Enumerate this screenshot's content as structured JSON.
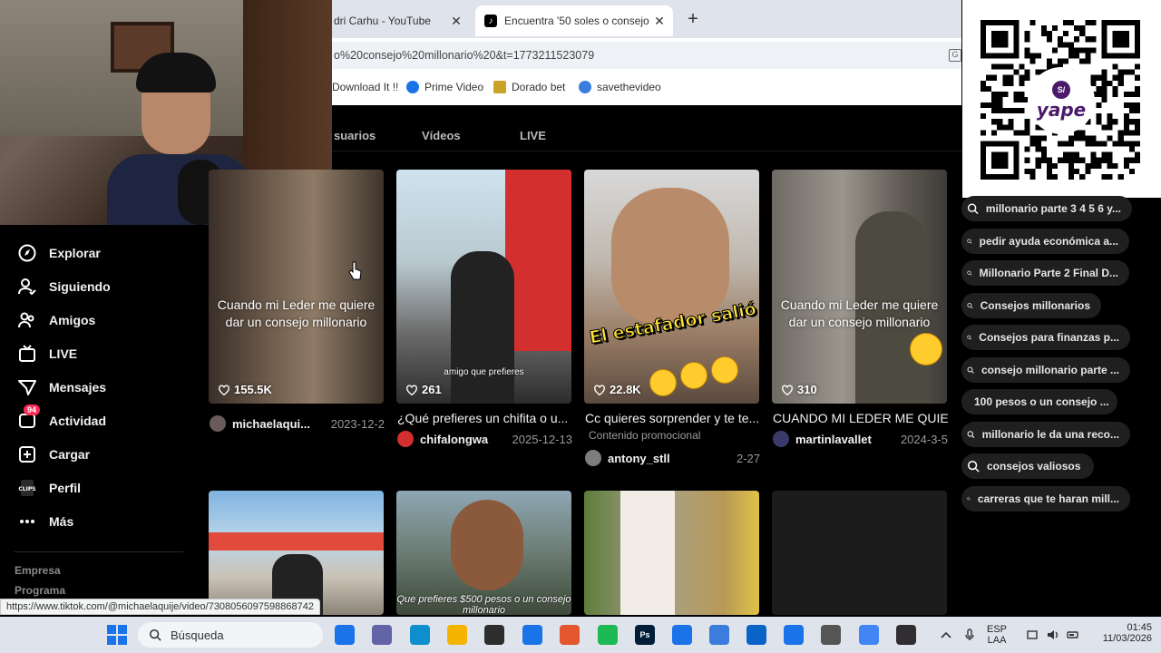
{
  "browser": {
    "tabs": [
      {
        "label": "dri Carhu - YouTube",
        "close": "✕"
      },
      {
        "label": "Encuentra '50 soles o consejo m",
        "close": "✕",
        "favicon": "tiktok-icon"
      }
    ],
    "new_tab": "+",
    "url": "o%20consejo%20millonario%20&t=1773211523079",
    "bookmarks": [
      {
        "label": "Download It !!",
        "icon": "download-icon"
      },
      {
        "label": "Prime Video",
        "icon": "prime-video-icon",
        "color": "#1a73e8"
      },
      {
        "label": "Dorado bet",
        "icon": "dorado-bet-icon",
        "color": "#c9a227"
      },
      {
        "label": "savethevideo",
        "icon": "savethevideo-icon",
        "color": "#3b7ddd"
      }
    ]
  },
  "search_tabs": [
    "suarios",
    "Vídeos",
    "LIVE"
  ],
  "sidebar": {
    "items": [
      {
        "label": "Explorar",
        "icon": "compass-icon"
      },
      {
        "label": "Siguiendo",
        "icon": "following-icon"
      },
      {
        "label": "Amigos",
        "icon": "friends-icon"
      },
      {
        "label": "LIVE",
        "icon": "live-icon"
      },
      {
        "label": "Mensajes",
        "icon": "messages-icon"
      },
      {
        "label": "Actividad",
        "icon": "activity-icon",
        "badge": "94"
      },
      {
        "label": "Cargar",
        "icon": "upload-icon"
      },
      {
        "label": "Perfil",
        "icon": "profile-icon"
      },
      {
        "label": "Más",
        "icon": "more-icon"
      }
    ],
    "footer": [
      "Empresa",
      "Programa"
    ]
  },
  "videos": [
    {
      "overlay": "Cuando mi Leder me quiere dar un consejo millonario",
      "likes": "155.5K",
      "title": "",
      "user": "michaelaqui...",
      "date": "2023-12-2"
    },
    {
      "overlay": "amigo que prefieres",
      "likes": "261",
      "title": "¿Qué prefieres un chifita o u...",
      "user": "chifalongwa",
      "date": "2025-12-13"
    },
    {
      "overlay": "El estafador salió estafado",
      "likes": "22.8K",
      "title": "Cc quieres sorprender y te te...",
      "promo": "Contenido promocional",
      "user": "antony_stll",
      "date": "2-27"
    },
    {
      "overlay": "Cuando mi Leder me quiere dar un consejo millonario",
      "likes": "310",
      "title": "CUANDO MI LEDER ME QUIE...",
      "user": "martinlavallet",
      "date": "2024-3-5"
    },
    {
      "overlay": ""
    },
    {
      "overlay": "Que prefieres $500 pesos o un consejo millonario"
    },
    {
      "overlay": ""
    },
    {
      "overlay": ""
    }
  ],
  "related_searches": [
    "millonario parte 3 4 5 6 y...",
    "pedir ayuda económica a...",
    "Millonario Parte 2 Final D...",
    "Consejos millonarios",
    "Consejos para finanzas p...",
    "consejo millonario parte ...",
    "100 pesos o un consejo ...",
    "millonario le da una reco...",
    "consejos valiosos",
    "carreras que te haran mill..."
  ],
  "qr": {
    "brand": "yape",
    "disc": "S/"
  },
  "status_url": "https://www.tiktok.com/@michaelaquije/video/7308056097598868742",
  "taskbar": {
    "search": "Búsqueda",
    "lang_top": "ESP",
    "lang_bottom": "LAA",
    "time": "01:45",
    "date": "11/03/2026",
    "apps": [
      {
        "name": "task-view-icon",
        "label": "",
        "color": "#1a73e8"
      },
      {
        "name": "teams-icon",
        "label": "",
        "color": "#6264a7"
      },
      {
        "name": "edge-icon",
        "label": "",
        "color": "#0c8ecf"
      },
      {
        "name": "explorer-icon",
        "label": "",
        "color": "#f4b400"
      },
      {
        "name": "store-icon",
        "label": "",
        "color": "#2d2d2d"
      },
      {
        "name": "mail-icon",
        "label": "",
        "color": "#1a73e8"
      },
      {
        "name": "media-icon",
        "label": "",
        "color": "#e4572e"
      },
      {
        "name": "spotify-icon",
        "label": "",
        "color": "#1db954"
      },
      {
        "name": "photoshop-icon",
        "label": "Ps",
        "color": "#001e36"
      },
      {
        "name": "onedrive-icon",
        "label": "",
        "color": "#1a73e8"
      },
      {
        "name": "notepad-icon",
        "label": "",
        "color": "#3b7ddd"
      },
      {
        "name": "outlook-icon",
        "label": "",
        "color": "#0a64c7"
      },
      {
        "name": "calendar-icon",
        "label": "",
        "color": "#1a73e8"
      },
      {
        "name": "calculator-icon",
        "label": "",
        "color": "#555"
      },
      {
        "name": "chrome-icon",
        "label": "",
        "color": "#4285f4"
      },
      {
        "name": "obs-icon",
        "label": "",
        "color": "#302e31"
      }
    ]
  }
}
